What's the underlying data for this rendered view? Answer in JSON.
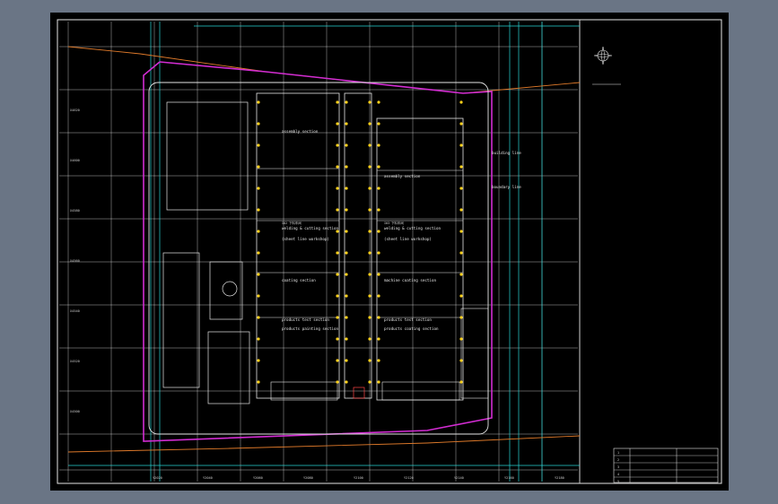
{
  "drawing": {
    "colors": {
      "background": "#000000",
      "frame_outer": "#6a7585",
      "grid": "#ffffff",
      "road_cyan": "#27d3d3",
      "boundary_orange": "#e07a2a",
      "fence_magenta": "#d22cd2",
      "structure_white": "#e6e6e6",
      "fixture_yellow": "#ffd21a",
      "annot_green": "#3de03d"
    },
    "north_arrow_icon": "north-arrow-icon",
    "coordinates": {
      "left": [
        "X4620",
        "X4600",
        "X4580",
        "X4560",
        "X4540",
        "X4520",
        "X4500"
      ],
      "bottom": [
        "Y2020",
        "Y2040",
        "Y2060",
        "Y2080",
        "Y2100",
        "Y2120",
        "Y2140",
        "Y2160",
        "Y2180"
      ]
    },
    "workshops": [
      {
        "label": "assembly section",
        "sub": ""
      },
      {
        "label": "welding & cutting section",
        "sub": "I02 下料车间"
      },
      {
        "label": "(sheet line workshop)",
        "sub": ""
      },
      {
        "label": "coating section",
        "sub": ""
      },
      {
        "label": "products test section",
        "sub": ""
      },
      {
        "label": "products painting section",
        "sub": ""
      },
      {
        "label": "welding & cutting section",
        "sub": "I03 下料车间"
      },
      {
        "label": "(sheet line workshop)",
        "sub": ""
      },
      {
        "label": "machine coating section",
        "sub": ""
      },
      {
        "label": "products test section",
        "sub": ""
      },
      {
        "label": "products coating section",
        "sub": ""
      },
      {
        "label": "assembly section",
        "sub": ""
      },
      {
        "label": "building line",
        "sub": ""
      },
      {
        "label": "boundary line",
        "sub": ""
      }
    ],
    "title_block": {
      "rows": [
        "1",
        "2",
        "3",
        "4",
        "5"
      ],
      "right_cells": [
        "",
        "",
        "",
        "",
        ""
      ]
    }
  }
}
